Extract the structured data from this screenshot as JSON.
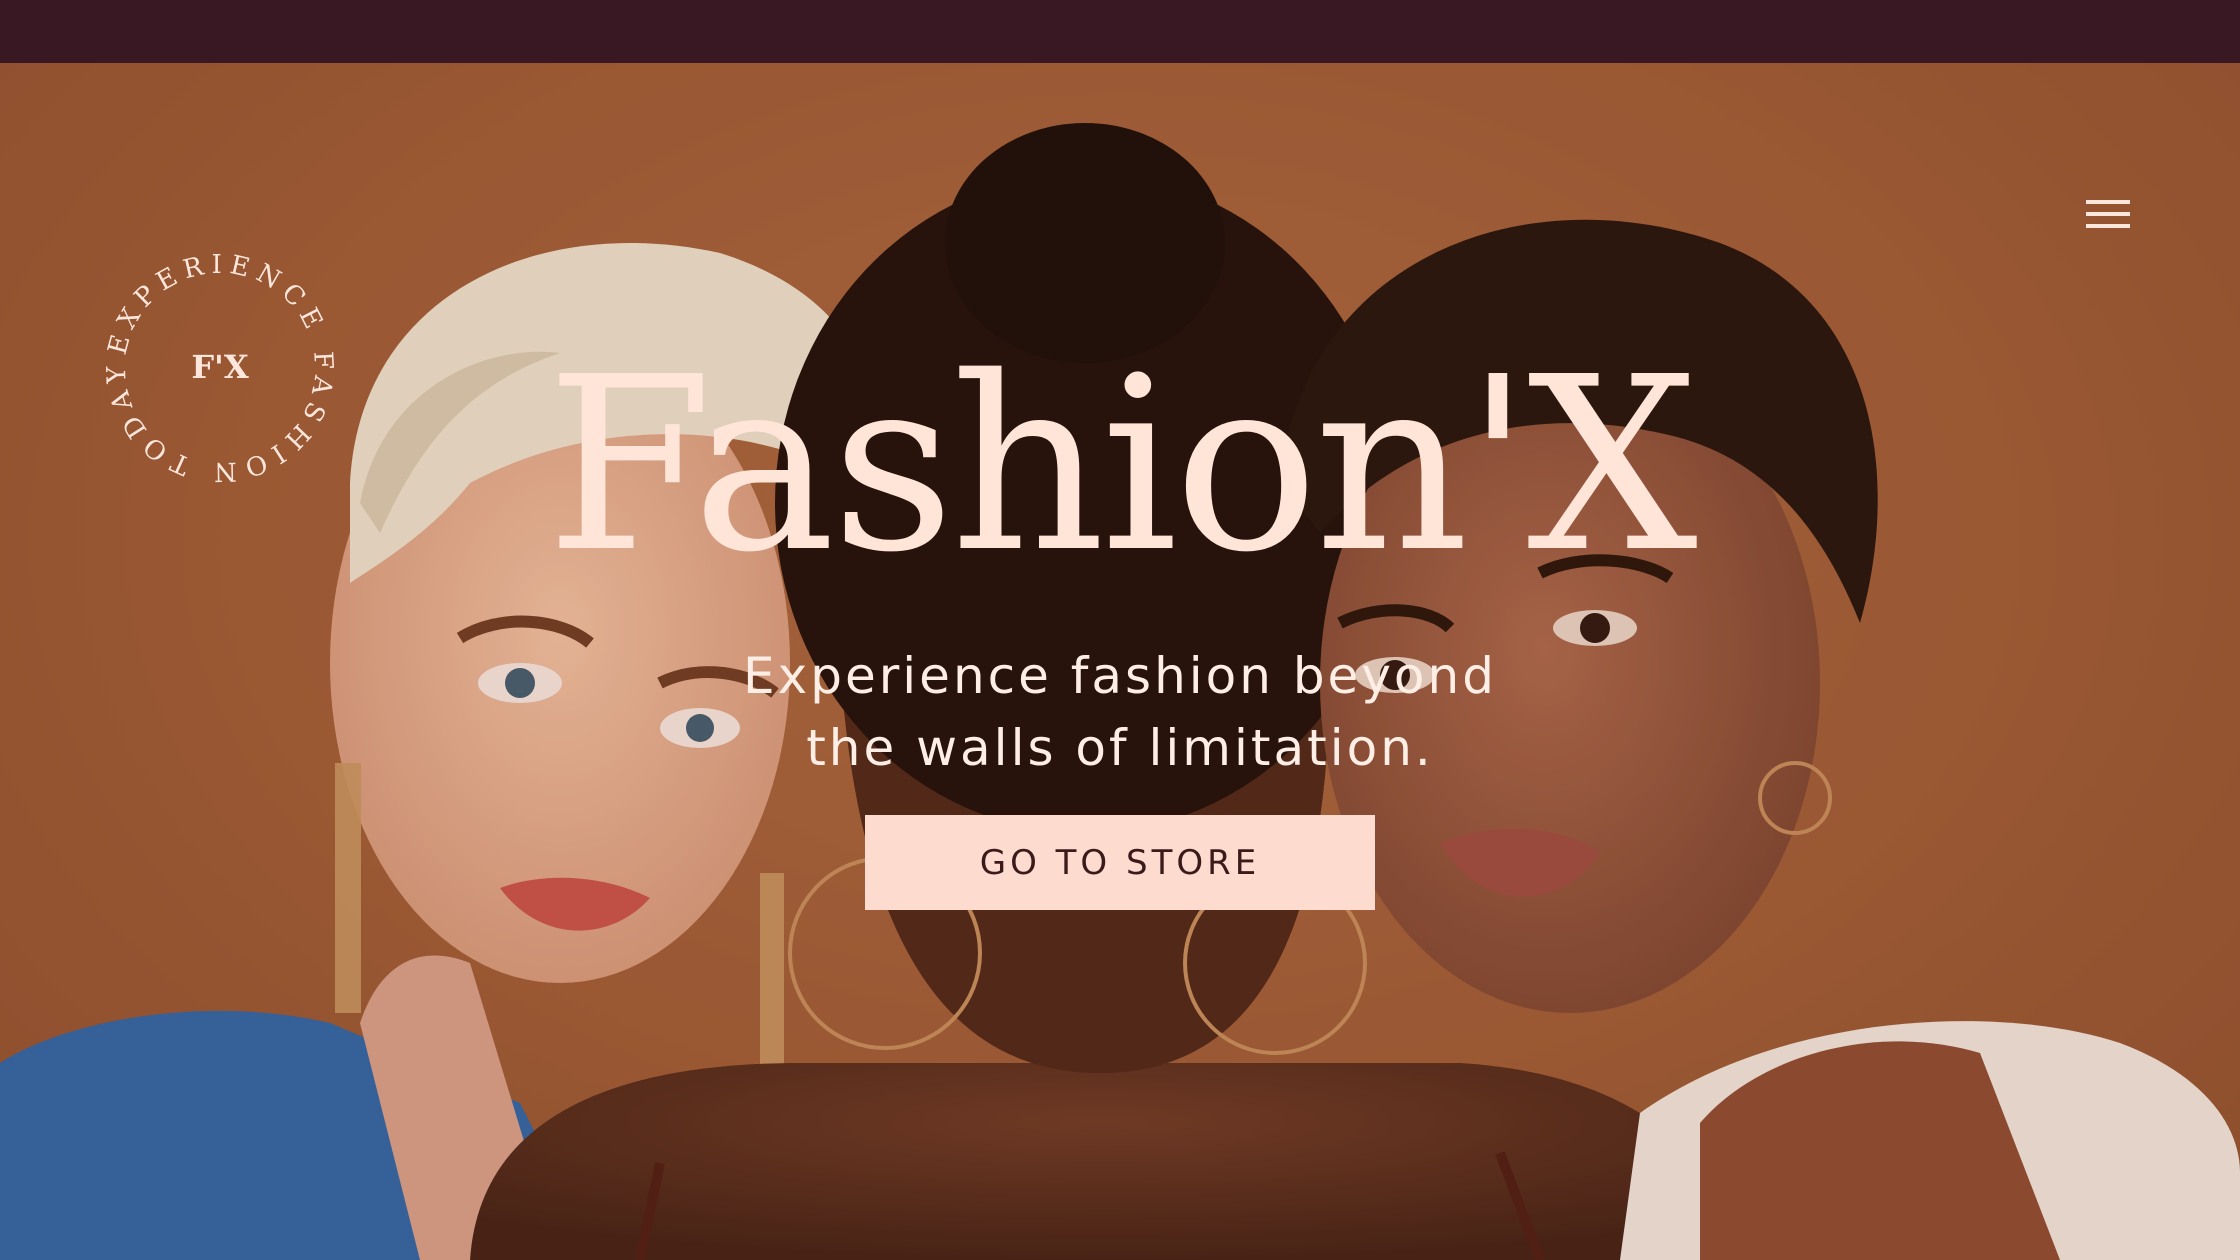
{
  "logo": {
    "ring_text": "EXPERIENCE FASHION TODAY",
    "monogram": "F'X"
  },
  "nav": {
    "menu_icon": "hamburger-menu-icon"
  },
  "hero": {
    "title": "Fashion'X",
    "subtitle_line1": "Experience fashion beyond",
    "subtitle_line2": "the walls of limitation.",
    "cta_label": "GO TO STORE",
    "image_description_icon": "three-models-photo"
  },
  "colors": {
    "top_bar": "#3a1823",
    "background": "#9c5a35",
    "title_text": "#ffe4d8",
    "button_bg": "#fddccf",
    "button_text": "#3a1a1a"
  }
}
